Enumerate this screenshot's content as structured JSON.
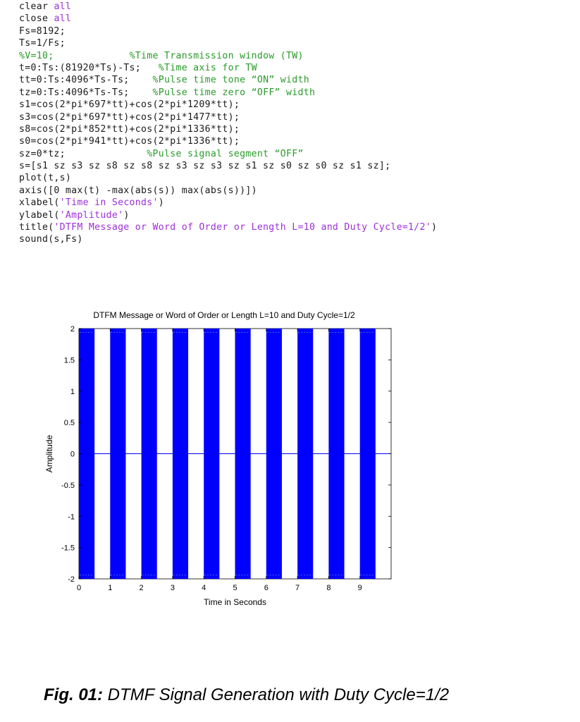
{
  "code": {
    "lines": [
      [
        {
          "t": "clear "
        },
        {
          "t": "all",
          "c": "kw"
        }
      ],
      [
        {
          "t": "close "
        },
        {
          "t": "all",
          "c": "kw"
        }
      ],
      [
        {
          "t": "Fs=8192;"
        }
      ],
      [
        {
          "t": "Ts=1/Fs;"
        }
      ],
      [
        {
          "t": "%V=10;",
          "c": "cm"
        },
        {
          "t": "             "
        },
        {
          "t": "%Time Transmission window (TW)",
          "c": "cm"
        }
      ],
      [
        {
          "t": "t=0:Ts:(81920*Ts)-Ts;"
        },
        {
          "t": "   "
        },
        {
          "t": "%Time axis for TW",
          "c": "cm"
        }
      ],
      [
        {
          "t": "tt=0:Ts:4096*Ts-Ts;"
        },
        {
          "t": "    "
        },
        {
          "t": "%Pulse time tone “ON” width",
          "c": "cm"
        }
      ],
      [
        {
          "t": "tz=0:Ts:4096*Ts-Ts;"
        },
        {
          "t": "    "
        },
        {
          "t": "%Pulse time zero “OFF” width",
          "c": "cm"
        }
      ],
      [
        {
          "t": "s1=cos(2*pi*697*tt)+cos(2*pi*1209*tt);"
        }
      ],
      [
        {
          "t": "s3=cos(2*pi*697*tt)+cos(2*pi*1477*tt);"
        }
      ],
      [
        {
          "t": "s8=cos(2*pi*852*tt)+cos(2*pi*1336*tt);"
        }
      ],
      [
        {
          "t": "s0=cos(2*pi*941*tt)+cos(2*pi*1336*tt);"
        }
      ],
      [
        {
          "t": "sz=0*tz;"
        },
        {
          "t": "              "
        },
        {
          "t": "%Pulse signal segment “OFF”",
          "c": "cm"
        }
      ],
      [
        {
          "t": "s=[s1 sz s3 sz s8 sz s8 sz s3 sz s3 sz s1 sz s0 sz s0 sz s1 sz];"
        }
      ],
      [
        {
          "t": "plot(t,s)"
        }
      ],
      [
        {
          "t": "axis([0 max(t) -max(abs(s)) max(abs(s))])"
        }
      ],
      [
        {
          "t": "xlabel("
        },
        {
          "t": "'Time in Seconds'",
          "c": "kw"
        },
        {
          "t": ")"
        }
      ],
      [
        {
          "t": "ylabel("
        },
        {
          "t": "'Amplitude'",
          "c": "kw"
        },
        {
          "t": ")"
        }
      ],
      [
        {
          "t": "title("
        },
        {
          "t": "'DTFM Message or Word of Order or Length L=10 and Duty Cycle=1/2'",
          "c": "kw"
        },
        {
          "t": ")"
        }
      ],
      [
        {
          "t": "sound(s,Fs)"
        }
      ]
    ]
  },
  "chart_data": {
    "type": "line",
    "title": "DTFM Message or Word of Order or Length L=10 and Duty Cycle=1/2",
    "xlabel": "Time in Seconds",
    "ylabel": "Amplitude",
    "xlim": [
      0,
      10
    ],
    "ylim": [
      -2,
      2
    ],
    "xticks": [
      "0",
      "1",
      "2",
      "3",
      "4",
      "5",
      "6",
      "7",
      "8",
      "9"
    ],
    "yticks": [
      "2",
      "1.5",
      "1",
      "0.5",
      "0",
      "-0.5",
      "-1",
      "-1.5",
      "-2"
    ],
    "series_color": "#0000ff",
    "tone_bursts": [
      {
        "start": 0.0,
        "end": 0.5
      },
      {
        "start": 1.0,
        "end": 1.5
      },
      {
        "start": 2.0,
        "end": 2.5
      },
      {
        "start": 3.0,
        "end": 3.5
      },
      {
        "start": 4.0,
        "end": 4.5
      },
      {
        "start": 5.0,
        "end": 5.5
      },
      {
        "start": 6.0,
        "end": 6.5
      },
      {
        "start": 7.0,
        "end": 7.5
      },
      {
        "start": 8.0,
        "end": 8.5
      },
      {
        "start": 9.0,
        "end": 9.5
      }
    ],
    "burst_amplitude": 2,
    "off_level": 0
  },
  "caption": {
    "label": "Fig. 01:",
    "text": " DTMF Signal Generation with  Duty Cycle=1/2"
  }
}
